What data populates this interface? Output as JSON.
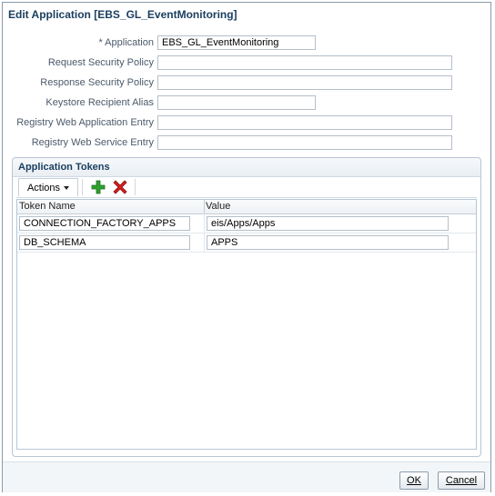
{
  "dialog": {
    "title": "Edit Application [EBS_GL_EventMonitoring]"
  },
  "form": {
    "required_marker": "* ",
    "fields": [
      {
        "label": "Application",
        "value": "EBS_GL_EventMonitoring",
        "required": true
      },
      {
        "label": "Request Security Policy",
        "value": ""
      },
      {
        "label": "Response Security Policy",
        "value": ""
      },
      {
        "label": "Keystore Recipient Alias",
        "value": ""
      },
      {
        "label": "Registry Web Application Entry",
        "value": ""
      },
      {
        "label": "Registry Web Service Entry",
        "value": ""
      }
    ]
  },
  "tokens": {
    "title": "Application Tokens",
    "actions_label": "Actions",
    "columns": [
      "Token Name",
      "Value"
    ],
    "rows": [
      {
        "name": "CONNECTION_FACTORY_APPS",
        "value": "eis/Apps/Apps"
      },
      {
        "name": "DB_SCHEMA",
        "value": "APPS"
      }
    ],
    "add_icon": "plus-icon",
    "delete_icon": "x-icon"
  },
  "buttons": {
    "ok": "OK",
    "cancel": "Cancel"
  },
  "colors": {
    "title": "#1b3f60",
    "add": "#2ea02e",
    "delete": "#d42020"
  }
}
